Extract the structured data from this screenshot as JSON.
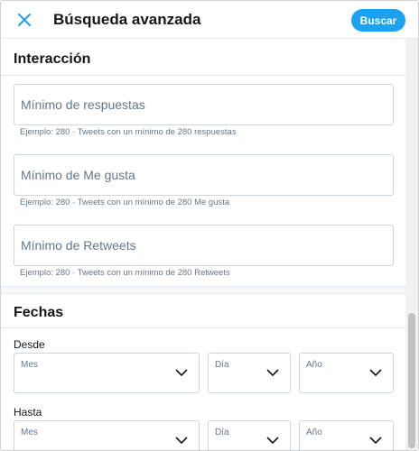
{
  "header": {
    "close_icon": "close-icon",
    "title": "Búsqueda avanzada",
    "search_label": "Buscar"
  },
  "interaction": {
    "title": "Interacción",
    "fields": [
      {
        "placeholder": "Mínimo de respuestas",
        "hint": "Ejemplo: 280 · Tweets con un mínimo de 280 respuestas"
      },
      {
        "placeholder": "Mínimo de Me gusta",
        "hint": "Ejemplo: 280 · Tweets con un mínimo de 280 Me gusta"
      },
      {
        "placeholder": "Mínimo de Retweets",
        "hint": "Ejemplo: 280 · Tweets con un mínimo de 280 Retweets"
      }
    ]
  },
  "dates": {
    "title": "Fechas",
    "from": {
      "label": "Desde",
      "month": "Mes",
      "day": "Día",
      "year": "Año"
    },
    "to": {
      "label": "Hasta",
      "month": "Mes",
      "day": "Día",
      "year": "Año"
    }
  },
  "colors": {
    "accent": "#1da1f2",
    "text": "#14171a",
    "muted": "#657786",
    "border": "#ccd6dd"
  }
}
